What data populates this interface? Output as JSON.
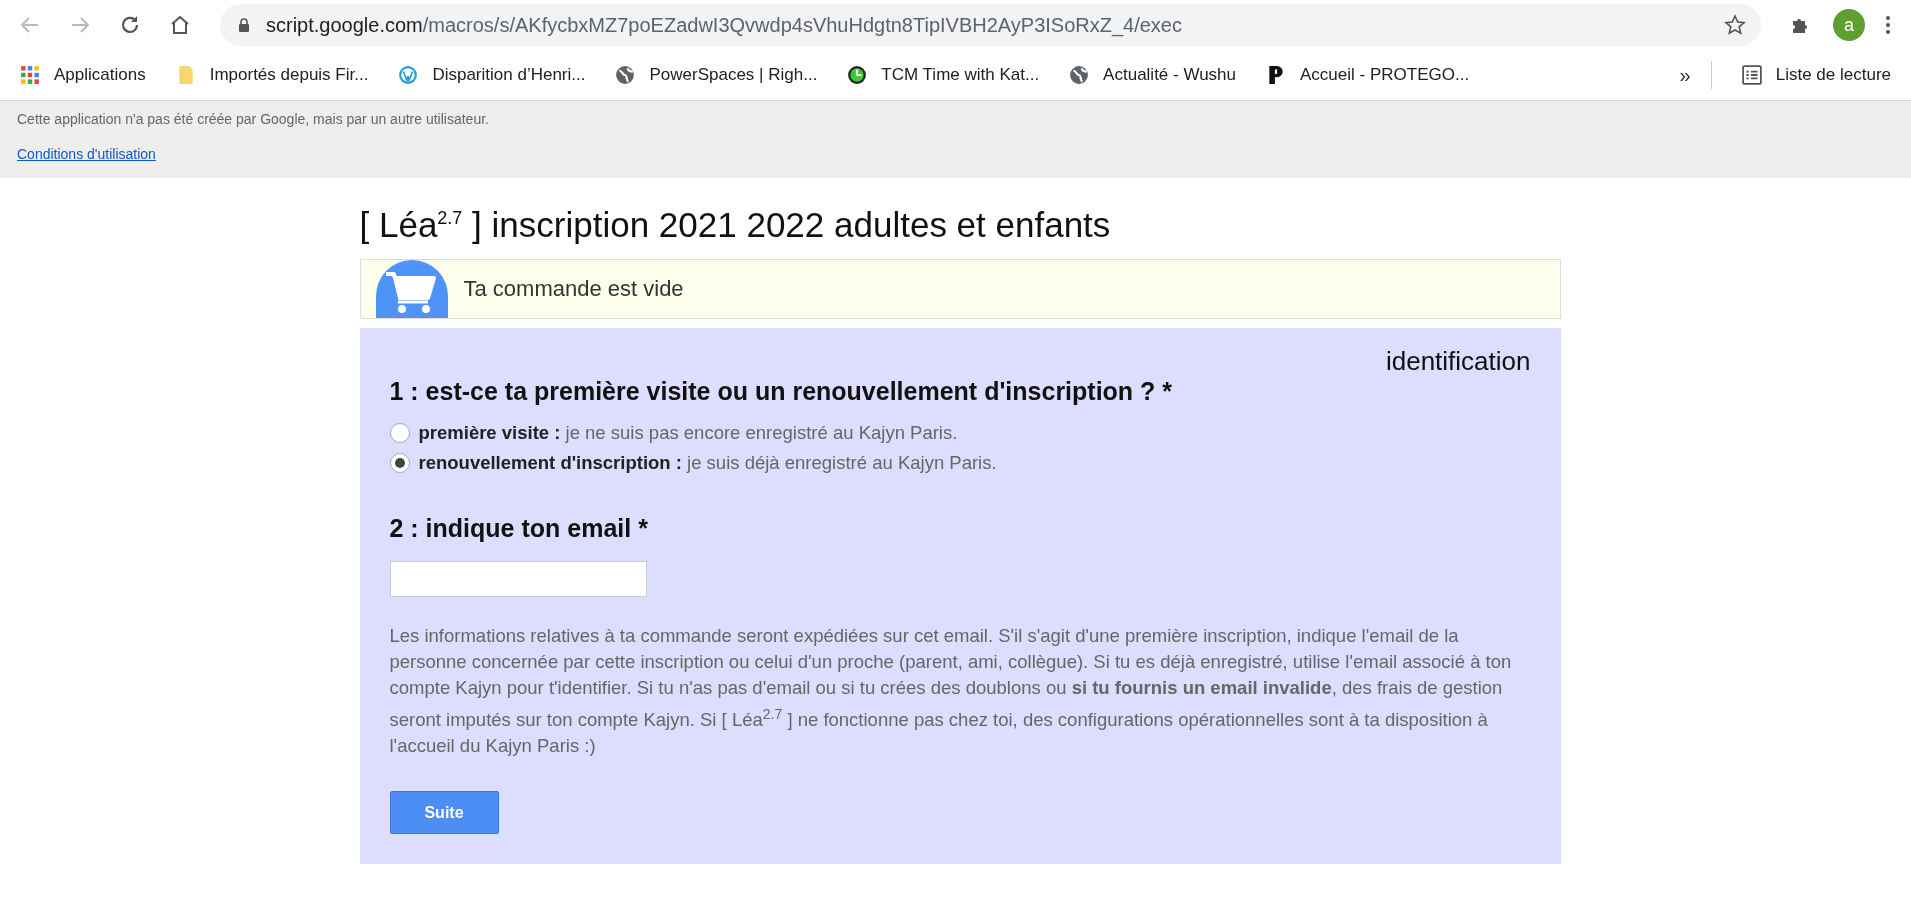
{
  "browser": {
    "url_host": "script.google.com",
    "url_path": "/macros/s/AKfycbxMZ7poEZadwI3Qvwdp4sVhuHdgtn8TipIVBH2AyP3ISoRxZ_4/exec",
    "profile": "a",
    "bookmarks": [
      {
        "kind": "apps",
        "label": "Applications"
      },
      {
        "kind": "folder",
        "label": "Importés depuis Fir..."
      },
      {
        "kind": "wordpress",
        "label": "Disparition d’Henri..."
      },
      {
        "kind": "globe",
        "label": "PowerSpaces | Righ..."
      },
      {
        "kind": "clock",
        "label": "TCM Time with Kat..."
      },
      {
        "kind": "globe",
        "label": "Actualité - Wushu"
      },
      {
        "kind": "p",
        "label": "Accueil - PROTEGO..."
      }
    ],
    "overflow": "»",
    "reading_list": "Liste de lecture"
  },
  "notice": {
    "text": "Cette application n'a pas été créée par Google, mais par un autre utilisateur.",
    "link": "Conditions d'utilisation"
  },
  "title": "[ Léa$^{2.7}$ ] inscription 2021 2022 adultes et enfants",
  "cart": {
    "text": "Ta commande est vide"
  },
  "form": {
    "section": "identification",
    "q1": "1 : est-ce ta première visite ou un renouvellement d'inscription ? *",
    "options": [
      {
        "text": "**première visite :** je ne suis pas encore enregistré au Kajyn Paris.",
        "selected": false
      },
      {
        "text": "**renouvellement d'inscription :** je suis déjà enregistré au Kajyn Paris.",
        "selected": true
      }
    ],
    "q2": "2 : indique ton email *",
    "help": "Les informations relatives à ta commande seront expédiées sur cet email. S'il s'agit d'une première inscription, indique l'email de la personne concernée par cette inscription ou celui d'un proche (parent, ami, collègue). Si tu es déjà enregistré, utilise l'email associé à ton compte Kajyn pour t'identifier. Si tu n'as pas d'email ou si tu crées des doublons ou **si tu fournis un email invalide**, des frais de gestion seront imputés sur ton compte Kajyn. Si [ Léa$^{2.7}$ ] ne fonctionne pas chez toi, des configurations opérationnelles sont à ta disposition à l'accueil du Kajyn Paris :)",
    "button": "Suite"
  }
}
